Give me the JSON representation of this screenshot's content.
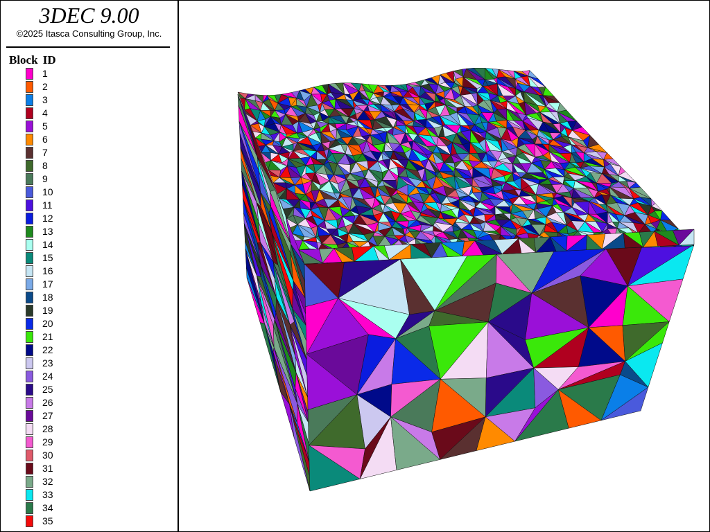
{
  "app": {
    "title": "3DEC 9.00",
    "copyright": "©2025 Itasca Consulting Group, Inc."
  },
  "legend": {
    "heading": "Block  ID",
    "items": [
      {
        "label": "1",
        "color": "#ff00cc"
      },
      {
        "label": "2",
        "color": "#ff5a00"
      },
      {
        "label": "3",
        "color": "#0a7fe8"
      },
      {
        "label": "4",
        "color": "#b0001f"
      },
      {
        "label": "5",
        "color": "#9a10d8"
      },
      {
        "label": "6",
        "color": "#ff8a00"
      },
      {
        "label": "7",
        "color": "#5a3030"
      },
      {
        "label": "8",
        "color": "#3f6a2c"
      },
      {
        "label": "9",
        "color": "#4a7a5a"
      },
      {
        "label": "10",
        "color": "#4a5adc"
      },
      {
        "label": "11",
        "color": "#4d10e0"
      },
      {
        "label": "12",
        "color": "#0a1ce0"
      },
      {
        "label": "13",
        "color": "#1e8a1e"
      },
      {
        "label": "14",
        "color": "#aafff0"
      },
      {
        "label": "15",
        "color": "#0a8a7a"
      },
      {
        "label": "16",
        "color": "#c6e6f4"
      },
      {
        "label": "17",
        "color": "#7aaae8"
      },
      {
        "label": "18",
        "color": "#0a4a8a"
      },
      {
        "label": "19",
        "color": "#2a3a2a"
      },
      {
        "label": "20",
        "color": "#0a2ae8"
      },
      {
        "label": "21",
        "color": "#3ae80a"
      },
      {
        "label": "22",
        "color": "#000a8a"
      },
      {
        "label": "23",
        "color": "#ccc8f0"
      },
      {
        "label": "24",
        "color": "#8a5ae0"
      },
      {
        "label": "25",
        "color": "#2a0a8a"
      },
      {
        "label": "26",
        "color": "#c87ae8"
      },
      {
        "label": "27",
        "color": "#6a0a9a"
      },
      {
        "label": "28",
        "color": "#f4dcf4"
      },
      {
        "label": "29",
        "color": "#f45ad0"
      },
      {
        "label": "30",
        "color": "#e05a6a"
      },
      {
        "label": "31",
        "color": "#6a0a1a"
      },
      {
        "label": "32",
        "color": "#7aaa8a"
      },
      {
        "label": "33",
        "color": "#0ae8f0"
      },
      {
        "label": "34",
        "color": "#2a7a4a"
      },
      {
        "label": "35",
        "color": "#f40a0a"
      }
    ]
  }
}
